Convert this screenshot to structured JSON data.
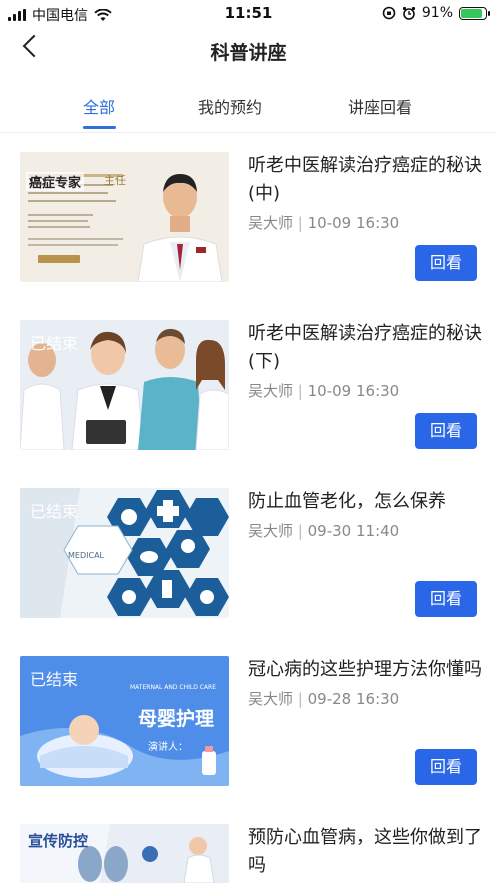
{
  "status_bar": {
    "carrier": "中国电信",
    "time": "11:51",
    "battery": "91%",
    "battery_level": 0.91
  },
  "header": {
    "title": "科普讲座"
  },
  "tabs": [
    {
      "label": "全部",
      "active": true
    },
    {
      "label": "我的预约",
      "active": false
    },
    {
      "label": "讲座回看",
      "active": false
    }
  ],
  "lectures": [
    {
      "title": "听老中医解读治疗癌症的秘诀(中)",
      "speaker": "吴大师",
      "datetime": "10-09 16:30",
      "action": "回看",
      "thumb_tag": ""
    },
    {
      "title": "听老中医解读治疗癌症的秘诀(下)",
      "speaker": "吴大师",
      "datetime": "10-09 16:30",
      "action": "回看",
      "thumb_tag": "已结束"
    },
    {
      "title": "防止血管老化，怎么保养",
      "speaker": "吴大师",
      "datetime": "09-30 11:40",
      "action": "回看",
      "thumb_tag": "已结束"
    },
    {
      "title": "冠心病的这些护理方法你懂吗",
      "speaker": "吴大师",
      "datetime": "09-28 16:30",
      "action": "回看",
      "thumb_tag": "已结束"
    },
    {
      "title": "预防心血管病，这些你做到了吗",
      "speaker": "",
      "datetime": "",
      "action": "",
      "thumb_tag": ""
    }
  ],
  "thumb_text": {
    "t1_role": "主任",
    "t3_medical": "MEDICAL",
    "t4_en": "MATERNAL AND CHILD CARE",
    "t4_title": "母婴护理",
    "t4_speaker": "演讲人：",
    "t5_title": "宣传防控"
  },
  "colors": {
    "accent": "#2f6fe0",
    "button": "#2a66e8"
  }
}
